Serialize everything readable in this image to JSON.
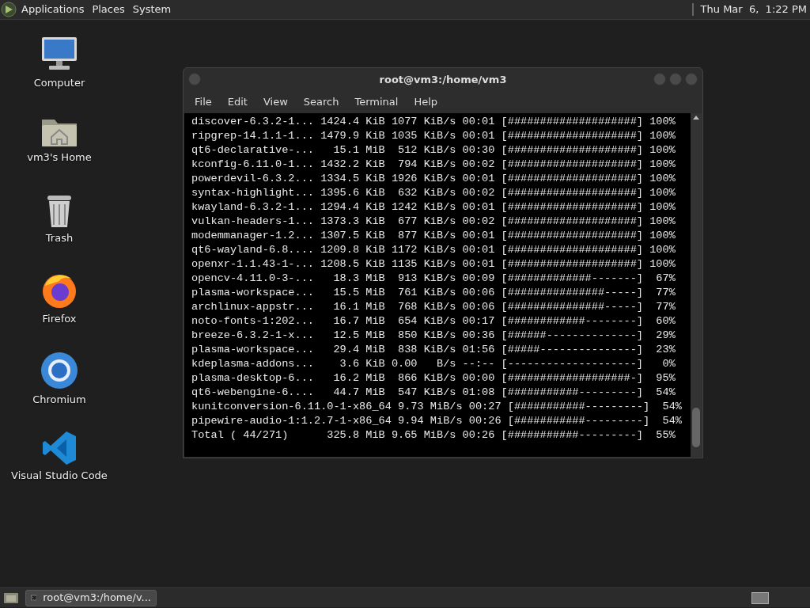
{
  "top_panel": {
    "menus": [
      "Applications",
      "Places",
      "System"
    ],
    "clock": "Thu Mar  6,  1:22 PM"
  },
  "desktop_icons": [
    {
      "label": "Computer",
      "kind": "computer"
    },
    {
      "label": "vm3's Home",
      "kind": "home"
    },
    {
      "label": "Trash",
      "kind": "trash"
    },
    {
      "label": "Firefox",
      "kind": "firefox"
    },
    {
      "label": "Chromium",
      "kind": "chromium"
    },
    {
      "label": "Visual Studio Code",
      "kind": "vscode"
    }
  ],
  "terminal": {
    "title": "root@vm3:/home/vm3",
    "menu": [
      "File",
      "Edit",
      "View",
      "Search",
      "Terminal",
      "Help"
    ],
    "lines": [
      "discover-6.3.2-1... 1424.4 KiB 1077 KiB/s 00:01 [####################] 100%",
      "ripgrep-14.1.1-1... 1479.9 KiB 1035 KiB/s 00:01 [####################] 100%",
      "qt6-declarative-...   15.1 MiB  512 KiB/s 00:30 [####################] 100%",
      "kconfig-6.11.0-1... 1432.2 KiB  794 KiB/s 00:02 [####################] 100%",
      "powerdevil-6.3.2... 1334.5 KiB 1926 KiB/s 00:01 [####################] 100%",
      "syntax-highlight... 1395.6 KiB  632 KiB/s 00:02 [####################] 100%",
      "kwayland-6.3.2-1... 1294.4 KiB 1242 KiB/s 00:01 [####################] 100%",
      "vulkan-headers-1... 1373.3 KiB  677 KiB/s 00:02 [####################] 100%",
      "modemmanager-1.2... 1307.5 KiB  877 KiB/s 00:01 [####################] 100%",
      "qt6-wayland-6.8.... 1209.8 KiB 1172 KiB/s 00:01 [####################] 100%",
      "openxr-1.1.43-1-... 1208.5 KiB 1135 KiB/s 00:01 [####################] 100%",
      "opencv-4.11.0-3-...   18.3 MiB  913 KiB/s 00:09 [#############-------]  67%",
      "plasma-workspace...   15.5 MiB  761 KiB/s 00:06 [###############-----]  77%",
      "archlinux-appstr...   16.1 MiB  768 KiB/s 00:06 [###############-----]  77%",
      "noto-fonts-1:202...   16.7 MiB  654 KiB/s 00:17 [############--------]  60%",
      "breeze-6.3.2-1-x...   12.5 MiB  850 KiB/s 00:36 [######--------------]  29%",
      "plasma-workspace...   29.4 MiB  838 KiB/s 01:56 [#####---------------]  23%",
      "kdeplasma-addons...    3.6 KiB 0.00   B/s --:-- [--------------------]   0%",
      "plasma-desktop-6...   16.2 MiB  866 KiB/s 00:00 [###################-]  95%",
      "qt6-webengine-6....   44.7 MiB  547 KiB/s 01:08 [###########---------]  54%",
      "kunitconversion-6.11.0-1-x86_64 9.73 MiB/s 00:27 [###########---------]  54%",
      "pipewire-audio-1:1.2.7-1-x86_64 9.94 MiB/s 00:26 [###########---------]  54%",
      "Total ( 44/271)      325.8 MiB 9.65 MiB/s 00:26 [###########---------]  55%"
    ]
  },
  "bottom_panel": {
    "tasks": [
      "root@vm3:/home/v..."
    ]
  }
}
